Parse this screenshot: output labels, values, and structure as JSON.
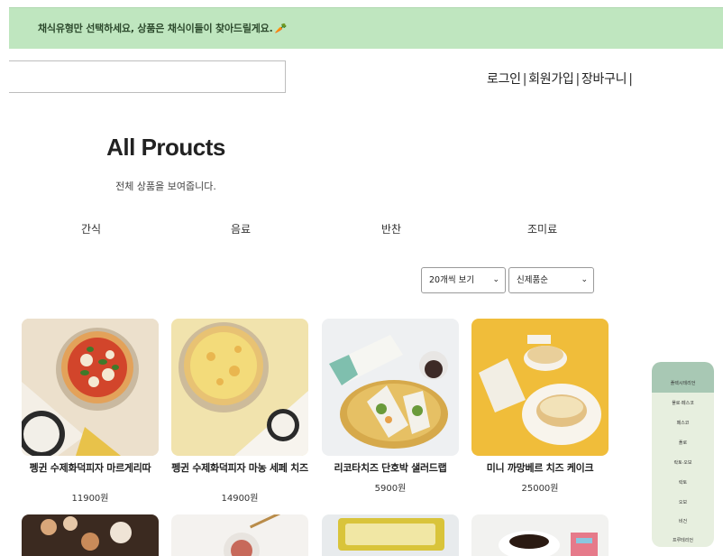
{
  "banner": {
    "text": "채식유형만 선택하세요, 상품은 채식이들이 찾아드릴게요.",
    "icon": "carrot-icon",
    "color": "#bfe6bf"
  },
  "search": {
    "value": "",
    "placeholder": ""
  },
  "user_nav": {
    "login": "로그인",
    "signup": "회원가입",
    "cart": "장바구니",
    "separator": "|"
  },
  "page": {
    "title": "All Proucts",
    "subtitle": "전체 상품을 보여줍니다."
  },
  "categories": [
    "간식",
    "음료",
    "반찬",
    "조미료"
  ],
  "filters": {
    "per_page": "20개씩 보기",
    "sort": "신제품순"
  },
  "products": [
    {
      "name": "펭귄 수제화덕피자 마르게리따",
      "price": "11900원"
    },
    {
      "name": "펭귄 수제화덕피자 마농 세페 치즈",
      "price": "14900원"
    },
    {
      "name": "리코타치즈 단호박 샐러드랩",
      "price": "5900원"
    },
    {
      "name": "미니 까망베르 치즈 케이크",
      "price": "25000원"
    }
  ],
  "sidebar": {
    "items": [
      "플렉시테리언",
      "폴로·페스코",
      "페스코",
      "폴로",
      "락토·오보",
      "락토",
      "오보",
      "비건",
      "프루테리언"
    ]
  },
  "colors": {
    "banner": "#bfe6bf",
    "sidebar_bg": "#e7efdf",
    "sidebar_head": "#a8c8b4"
  }
}
